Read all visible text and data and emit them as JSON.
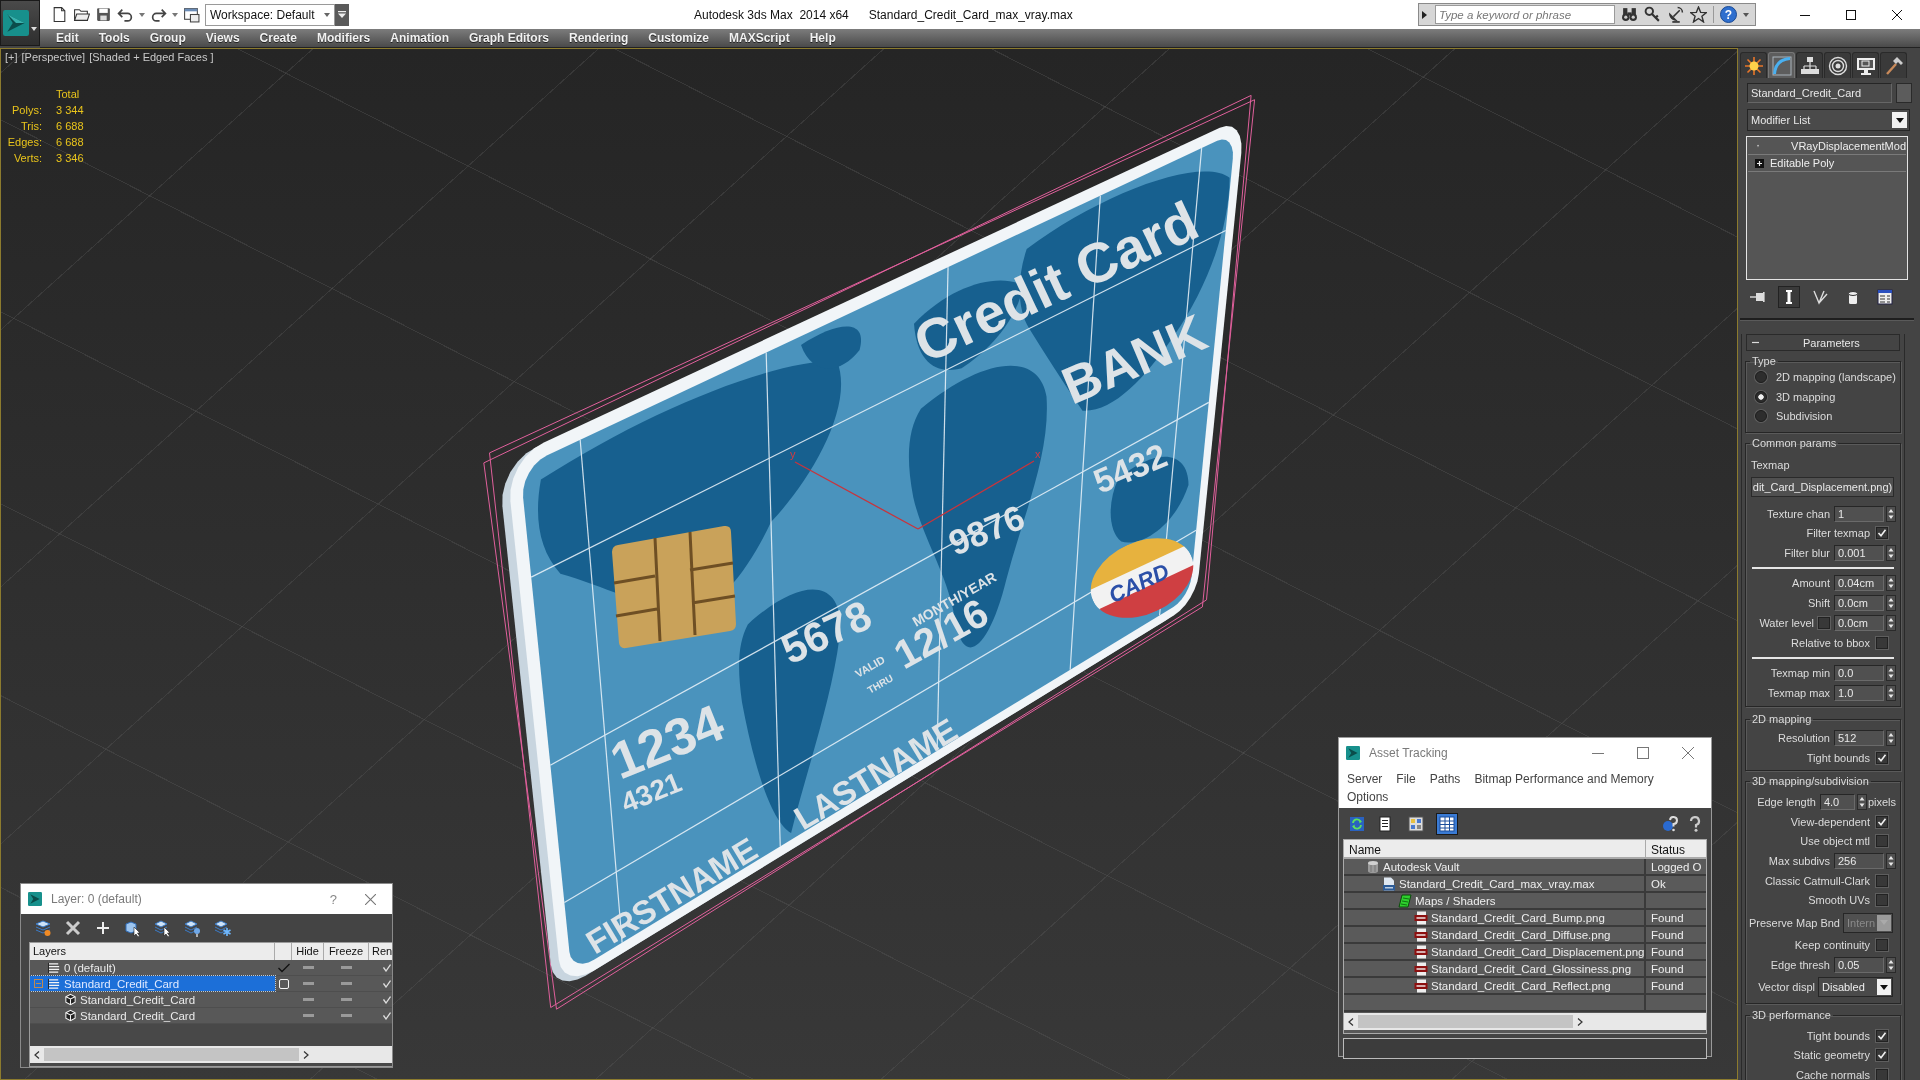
{
  "title_bar": {
    "workspace": "Workspace: Default",
    "app_name": "Autodesk 3ds Max  2014 x64",
    "file_name": "Standard_Credit_Card_max_vray.max",
    "search": {
      "placeholder": "Type a keyword or phrase"
    },
    "help": "?"
  },
  "menu_bar": [
    "Edit",
    "Tools",
    "Group",
    "Views",
    "Create",
    "Modifiers",
    "Animation",
    "Graph Editors",
    "Rendering",
    "Customize",
    "MAXScript",
    "Help"
  ],
  "viewport": {
    "labels": [
      "[+]",
      "[Perspective]",
      "[Shaded + Edged Faces ]"
    ],
    "stats": {
      "heading": "Total",
      "rows": [
        {
          "label": "Polys:",
          "value": "3 344"
        },
        {
          "label": "Tris:",
          "value": "6 688"
        },
        {
          "label": "Edges:",
          "value": "6 688"
        },
        {
          "label": "Verts:",
          "value": "3 346"
        }
      ]
    },
    "card": {
      "title": "Credit Card",
      "bank": "BANK",
      "numbers": [
        "1234",
        "5678",
        "9876",
        "5432"
      ],
      "sub_number": "4321",
      "expiry_label": "MONTH/YEAR",
      "valid_label_lines": [
        "VALID",
        "THRU"
      ],
      "expiry": "12/16",
      "holder_words": [
        "FIRSTNAME",
        "LASTNAME"
      ],
      "brand": "CARD"
    },
    "gizmo_axes": [
      "y",
      "x"
    ]
  },
  "command_panel": {
    "tabs": [
      {
        "kind": "create",
        "selected": false
      },
      {
        "kind": "modify",
        "selected": true
      },
      {
        "kind": "hierarchy",
        "selected": false
      },
      {
        "kind": "motion",
        "selected": false
      },
      {
        "kind": "display",
        "selected": false
      },
      {
        "kind": "utilities",
        "selected": false
      }
    ],
    "object_name": "Standard_Credit_Card",
    "modifier_list": "Modifier List",
    "stack": [
      {
        "kind": "modifier",
        "label": "VRayDisplacementMod",
        "enabled": true
      },
      {
        "kind": "object",
        "label": "Editable Poly",
        "expanded": false
      }
    ],
    "stack_tools": [
      {
        "kind": "pin",
        "on": false
      },
      {
        "kind": "endresult",
        "on": true
      },
      {
        "kind": "unique",
        "on": false
      },
      {
        "kind": "remove",
        "on": false
      },
      {
        "kind": "configure",
        "on": false
      }
    ],
    "rollout": {
      "title": "Parameters",
      "expanded": true,
      "groups": [
        {
          "title": "Type",
          "rows": [
            {
              "kind": "radio",
              "label": "2D mapping (landscape)",
              "selected": false
            },
            {
              "kind": "radio",
              "label": "3D mapping",
              "selected": true
            },
            {
              "kind": "radio",
              "label": "Subdivision",
              "selected": false
            }
          ]
        },
        {
          "title": "Common params",
          "rows": [
            {
              "kind": "text",
              "label": "Texmap"
            },
            {
              "kind": "mapbutton",
              "value": "dit_Card_Displacement.png)"
            },
            {
              "kind": "spinner",
              "label": "Texture chan",
              "value": "1"
            },
            {
              "kind": "checkbox",
              "label": "Filter texmap",
              "checked": true
            },
            {
              "kind": "spinner",
              "label": "Filter blur",
              "value": "0.001"
            },
            {
              "kind": "separator"
            },
            {
              "kind": "spinner",
              "label": "Amount",
              "value": "0.04cm"
            },
            {
              "kind": "spinner",
              "label": "Shift",
              "value": "0.0cm"
            },
            {
              "kind": "checkspinner",
              "label": "Water level",
              "checked": false,
              "value": "0.0cm"
            },
            {
              "kind": "checkbox",
              "label": "Relative to bbox",
              "checked": false
            },
            {
              "kind": "separator"
            },
            {
              "kind": "spinner",
              "label": "Texmap min",
              "value": "0.0"
            },
            {
              "kind": "spinner",
              "label": "Texmap max",
              "value": "1.0"
            }
          ]
        },
        {
          "title": "2D mapping",
          "rows": [
            {
              "kind": "spinner",
              "label": "Resolution",
              "value": "512"
            },
            {
              "kind": "checkbox",
              "label": "Tight bounds",
              "checked": true
            }
          ]
        },
        {
          "title": "3D mapping/subdivision",
          "rows": [
            {
              "kind": "spinner",
              "label": "Edge length",
              "value": "4.0",
              "unit": "pixels"
            },
            {
              "kind": "checkbox",
              "label": "View-dependent",
              "checked": true
            },
            {
              "kind": "checkbox",
              "label": "Use object mtl",
              "checked": false
            },
            {
              "kind": "spinner",
              "label": "Max subdivs",
              "value": "256"
            },
            {
              "kind": "checkbox",
              "label": "Classic Catmull-Clark",
              "checked": false
            },
            {
              "kind": "checkbox",
              "label": "Smooth UVs",
              "checked": false
            },
            {
              "kind": "dropdown",
              "label": "Preserve Map Bnd",
              "value": "Intern",
              "disabled": true
            },
            {
              "kind": "checkbox",
              "label": "Keep continuity",
              "checked": false
            },
            {
              "kind": "spinner",
              "label": "Edge thresh",
              "value": "0.05"
            },
            {
              "kind": "dropdown",
              "label": "Vector displ",
              "value": "Disabled",
              "disabled": false
            }
          ]
        },
        {
          "title": "3D performance",
          "rows": [
            {
              "kind": "checkbox",
              "label": "Tight bounds",
              "checked": true
            },
            {
              "kind": "checkbox",
              "label": "Static geometry",
              "checked": true
            },
            {
              "kind": "checkbox",
              "label": "Cache normals",
              "checked": false
            }
          ]
        }
      ]
    }
  },
  "layer_window": {
    "title": "Layer: 0 (default)",
    "help": "?",
    "columns": [
      "Layers",
      "Hide",
      "Freeze",
      "Ren"
    ],
    "rows": [
      {
        "kind": "layer",
        "name": "0 (default)",
        "current": true,
        "selected": false,
        "hidden": false,
        "frozen": false,
        "renderable": true
      },
      {
        "kind": "layer",
        "name": "Standard_Credit_Card",
        "current": false,
        "selected": true,
        "expanded": true,
        "hidden": false,
        "frozen": false,
        "renderable": true,
        "children": [
          {
            "kind": "object",
            "name": "Standard_Credit_Card",
            "selected": false,
            "hidden": false,
            "frozen": false,
            "renderable": true
          },
          {
            "kind": "object",
            "name": "Standard_Credit_Card",
            "selected": false,
            "hidden": false,
            "frozen": false,
            "renderable": true
          }
        ]
      }
    ]
  },
  "asset_window": {
    "title": "Asset Tracking",
    "menu": [
      "Server",
      "File",
      "Paths",
      "Bitmap Performance and Memory",
      "Options"
    ],
    "view_modes": [
      {
        "kind": "list",
        "selected": false
      },
      {
        "kind": "thumbnails",
        "selected": false
      },
      {
        "kind": "table",
        "selected": true
      }
    ],
    "columns": [
      "Name",
      "Status"
    ],
    "tree": [
      {
        "kind": "vault",
        "name": "Autodesk Vault",
        "status": "Logged O",
        "children": [
          {
            "kind": "maxfile",
            "name": "Standard_Credit_Card_max_vray.max",
            "status": "Ok",
            "children": [
              {
                "kind": "folder",
                "name": "Maps / Shaders",
                "children": [
                  {
                    "kind": "image",
                    "name": "Standard_Credit_Card_Bump.png",
                    "status": "Found"
                  },
                  {
                    "kind": "image",
                    "name": "Standard_Credit_Card_Diffuse.png",
                    "status": "Found"
                  },
                  {
                    "kind": "image",
                    "name": "Standard_Credit_Card_Displacement.png",
                    "status": "Found"
                  },
                  {
                    "kind": "image",
                    "name": "Standard_Credit_Card_Glossiness.png",
                    "status": "Found"
                  },
                  {
                    "kind": "image",
                    "name": "Standard_Credit_Card_Reflect.png",
                    "status": "Found"
                  }
                ]
              }
            ]
          }
        ]
      }
    ]
  }
}
